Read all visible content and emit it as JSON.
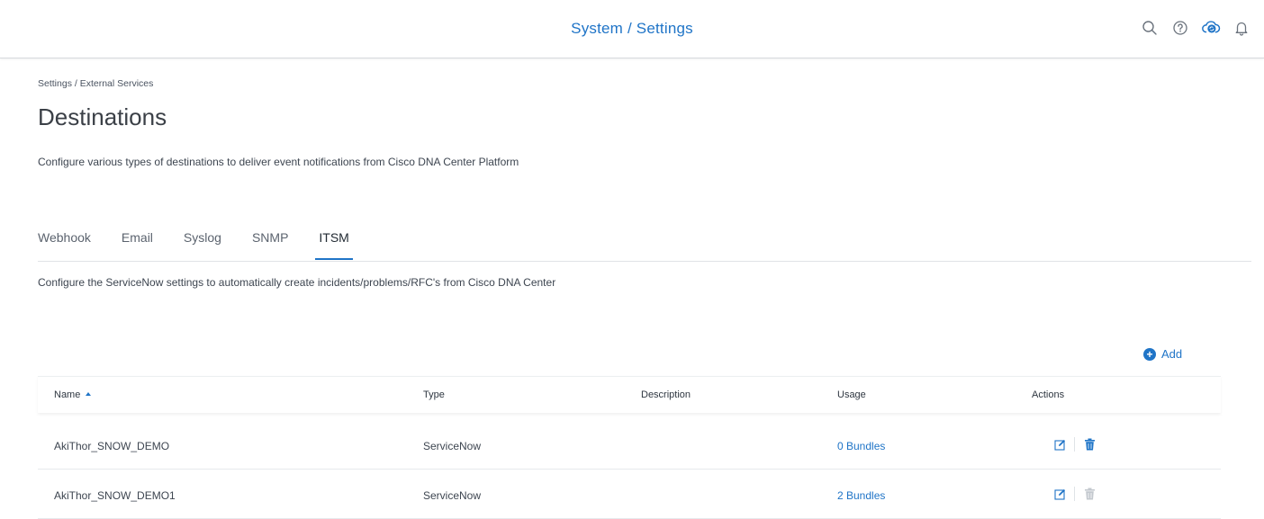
{
  "header": {
    "title": "System / Settings",
    "icons": [
      "search-icon",
      "help-icon",
      "cloud-sync-icon",
      "notifications-bell-icon"
    ]
  },
  "breadcrumb": "Settings / External Services",
  "page": {
    "title": "Destinations",
    "description": "Configure various types of destinations to deliver event notifications from Cisco DNA Center Platform"
  },
  "tabs": [
    {
      "label": "Webhook",
      "active": false
    },
    {
      "label": "Email",
      "active": false
    },
    {
      "label": "Syslog",
      "active": false
    },
    {
      "label": "SNMP",
      "active": false
    },
    {
      "label": "ITSM",
      "active": true
    }
  ],
  "itsm": {
    "description": "Configure the ServiceNow settings to automatically create incidents/problems/RFC's from Cisco DNA Center",
    "add_label": "Add"
  },
  "table": {
    "columns": [
      "Name",
      "Type",
      "Description",
      "Usage",
      "Actions"
    ],
    "sort_column": "Name",
    "rows": [
      {
        "name": "AkiThor_SNOW_DEMO",
        "type": "ServiceNow",
        "description": "",
        "usage": "0 Bundles",
        "delete_enabled": true
      },
      {
        "name": "AkiThor_SNOW_DEMO1",
        "type": "ServiceNow",
        "description": "",
        "usage": "2 Bundles",
        "delete_enabled": false
      }
    ]
  },
  "colors": {
    "accent": "#1f74c7",
    "text": "#3d4550",
    "disabled": "#c3c8ce"
  }
}
